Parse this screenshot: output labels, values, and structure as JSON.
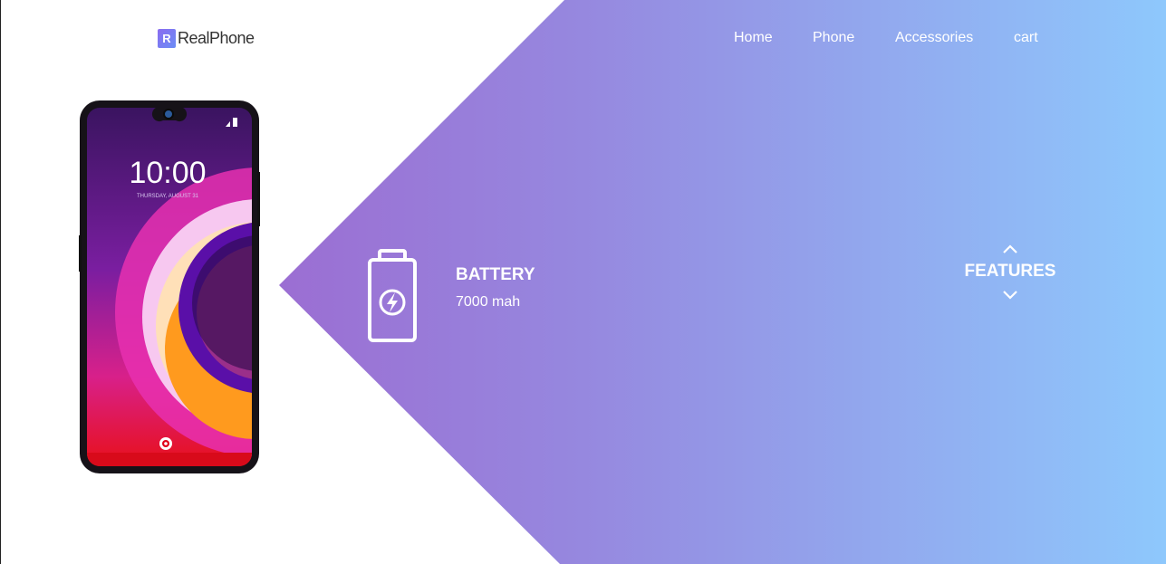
{
  "brand": {
    "logo_mark": "R",
    "name": "RealPhone"
  },
  "nav": {
    "items": [
      {
        "label": "Home"
      },
      {
        "label": "Phone"
      },
      {
        "label": "Accessories"
      },
      {
        "label": "cart"
      }
    ]
  },
  "phone_screen": {
    "time": "10:00",
    "date": "THURSDAY, AUGUST 31"
  },
  "feature": {
    "icon": "battery-charging-icon",
    "title": "BATTERY",
    "value": "7000 mah"
  },
  "features_nav": {
    "label": "FEATURES",
    "up_icon": "chevron-up-icon",
    "down_icon": "chevron-down-icon"
  },
  "colors": {
    "gradient_start": "#9a57c9",
    "gradient_end": "#8ec8fc",
    "text_on_gradient": "#ffffff"
  }
}
